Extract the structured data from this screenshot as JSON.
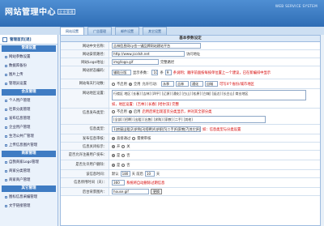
{
  "header": {
    "logo_text": "网站管理中心",
    "logo_tag": "企业管理",
    "system_text": "WEB SERVICE SYSTEM"
  },
  "tabs": [
    "网站设置",
    "广告管理",
    "邮件设置",
    "其它设置"
  ],
  "sidebar": {
    "top_label": "管理首页[退]",
    "groups": [
      {
        "title": "常规设置",
        "items": [
          "网站参数设置",
          "数据库备份",
          "图片上传",
          "管理员设置"
        ]
      },
      {
        "title": "会员管理",
        "items": [
          "个人用户管理",
          "社目分类管理",
          "发布信息管理",
          "企业用户管理",
          "生活公共广管理",
          "上传信息图片管理"
        ]
      },
      {
        "title": "商家管理",
        "items": [
          "自我商家Logo管理",
          "商家分类管理",
          "商家商户管理"
        ]
      },
      {
        "title": "其它管理",
        "items": [
          "图标信息采编管理",
          "文字链接管理"
        ]
      }
    ]
  },
  "main": {
    "title": "基本参数设定",
    "rows": {
      "site_name": {
        "label": "网站中文名称：",
        "value": "吉林信息网cy也一键品牌网站建站平台"
      },
      "site_domain": {
        "label": "网站安装路径：",
        "value": "http://www.jccdsh.net",
        "note": "访问地址"
      },
      "site_logo": {
        "label": "网站Logo地址：",
        "value": "img/logo.gif",
        "note": "完整路径"
      },
      "page_size": {
        "label": "网站状态编码：",
        "prefix": "辅助分版",
        "sub_label": "显示条数：",
        "count": "10",
        "sep": "条",
        "count2": "9",
        "note": "条说明；顺序前面按每按单位置上一个建议，已在新编排中显示"
      },
      "ad_limit": {
        "label": "网站每天行动数：",
        "options": [
          "不启用",
          "全用"
        ],
        "extra": "允许行动：",
        "values": [
          "永季",
          "吉林",
          "通化",
          "自城"
        ],
        "note_red": "可写4个省份/城市地区"
      },
      "area_cats": {
        "label": "网站地区设置：",
        "value": "行楼区 地区 [长春] [吉林] [四平] [辽源] [通化] [白山] [松原] [白城] [延边] [长白山] 商业地区",
        "note": "如，地区设置：[吉林] [长春] [哈尔滨] 完整"
      },
      "index_cats": {
        "label": "信息发布类型：",
        "options": [
          "不启用",
          "启用"
        ],
        "note": "启用后将出现首页分类显示，并对其全部分类",
        "value": "[全部] [招聘] [出租] [出售] [求购] [家教] [二手] [其他]"
      },
      "info_types": {
        "label": "信息类型：",
        "value": "1|房屋出租|2|求购|3|招聘|4|求职|5|二手|6|家教|7|其它|8|其他",
        "note": "如：信息类型与分类设置"
      },
      "audit": {
        "label": "发布信息审核：",
        "options": [
          "直接通过",
          "需要审核"
        ]
      },
      "show_close": {
        "label": "信息关闭标示：",
        "options": [
          "开",
          "关"
        ]
      },
      "allow_html": {
        "label": "是否允许注册用户发布：",
        "options": [
          "是",
          "否"
        ]
      },
      "allow_pic": {
        "label": "是否允许用户删除：",
        "options": [
          "是",
          "否"
        ]
      },
      "date_fmt": {
        "label": "该信息时间：",
        "prefix": "默认",
        "value": "180",
        "mid": "天 前后",
        "value2": "10",
        "suffix": "天"
      },
      "del_days": {
        "label": "信息停用时间（天）：",
        "value": "360",
        "note_red": "系统将自动删除过期信息"
      },
      "admin_bg": {
        "label": "后台背景图片：",
        "value": "house.gif",
        "btn": "更换"
      }
    }
  }
}
